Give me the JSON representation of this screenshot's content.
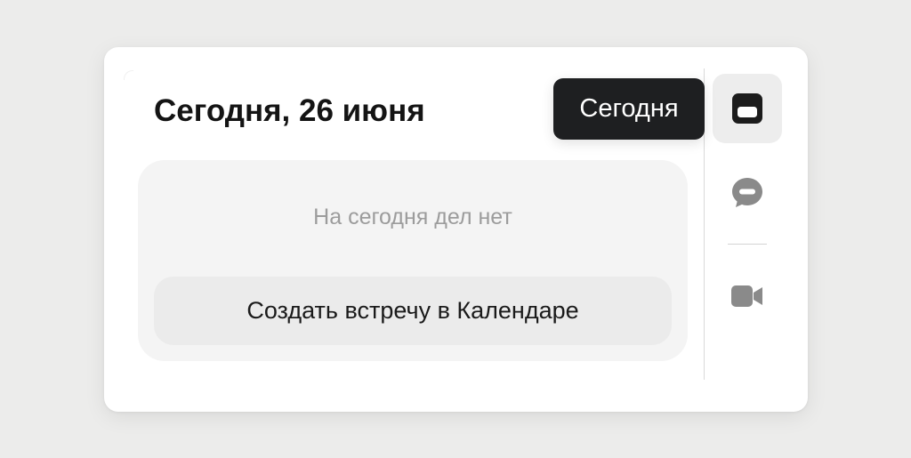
{
  "widget": {
    "title": "Сегодня, 26 июня",
    "empty_message": "На сегодня дел нет",
    "create_button_label": "Создать встречу в Календаре"
  },
  "sidebar": {
    "tooltip": "Сегодня",
    "buttons": [
      {
        "icon": "calendar-today-icon",
        "active": true
      },
      {
        "icon": "chat-icon",
        "active": false
      },
      {
        "icon": "video-camera-icon",
        "active": false
      }
    ]
  },
  "colors": {
    "background": "#ececeb",
    "card": "#ffffff",
    "icon_active": "#1c1c1c",
    "icon_inactive": "#8a8a8a",
    "tooltip_bg": "#1e1f21"
  }
}
